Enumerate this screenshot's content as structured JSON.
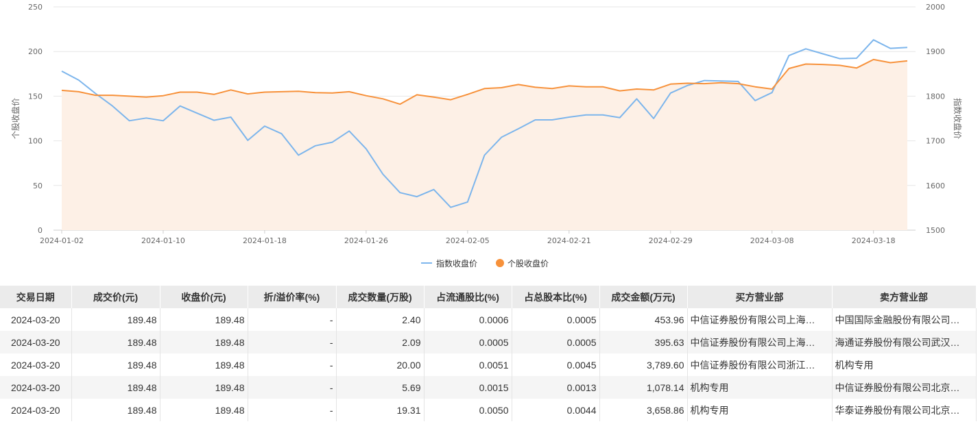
{
  "chart_data": {
    "type": "line",
    "x": [
      "2024-01-02",
      "2024-01-03",
      "2024-01-04",
      "2024-01-05",
      "2024-01-08",
      "2024-01-09",
      "2024-01-10",
      "2024-01-11",
      "2024-01-12",
      "2024-01-15",
      "2024-01-16",
      "2024-01-17",
      "2024-01-18",
      "2024-01-19",
      "2024-01-22",
      "2024-01-23",
      "2024-01-24",
      "2024-01-25",
      "2024-01-26",
      "2024-01-29",
      "2024-01-30",
      "2024-01-31",
      "2024-02-01",
      "2024-02-02",
      "2024-02-05",
      "2024-02-06",
      "2024-02-07",
      "2024-02-08",
      "2024-02-19",
      "2024-02-20",
      "2024-02-21",
      "2024-02-22",
      "2024-02-23",
      "2024-02-26",
      "2024-02-27",
      "2024-02-28",
      "2024-02-29",
      "2024-03-01",
      "2024-03-04",
      "2024-03-05",
      "2024-03-06",
      "2024-03-07",
      "2024-03-08",
      "2024-03-11",
      "2024-03-12",
      "2024-03-13",
      "2024-03-14",
      "2024-03-15",
      "2024-03-18",
      "2024-03-19",
      "2024-03-20"
    ],
    "x_ticks": [
      "2024-01-02",
      "2024-01-10",
      "2024-01-18",
      "2024-01-26",
      "2024-02-05",
      "2024-02-21",
      "2024-02-29",
      "2024-03-08",
      "2024-03-18"
    ],
    "left_axis": {
      "label": "个股收盘价",
      "min": 0,
      "max": 250,
      "ticks": [
        0,
        50,
        100,
        150,
        200,
        250
      ]
    },
    "right_axis": {
      "label": "指数收盘价",
      "min": 1500,
      "max": 2000,
      "ticks": [
        1500,
        1600,
        1700,
        1800,
        1900,
        2000
      ]
    },
    "grid": true,
    "legend_position": "bottom-center",
    "series": [
      {
        "name": "指数收盘价",
        "axis": "right",
        "type": "line",
        "color": "#7cb5ec",
        "values": [
          1856,
          1836,
          1806,
          1778,
          1745,
          1751,
          1745,
          1778,
          1762,
          1746,
          1753,
          1701,
          1733,
          1716,
          1668,
          1689,
          1697,
          1722,
          1682,
          1625,
          1584,
          1575,
          1591,
          1551,
          1563,
          1668,
          1708,
          1727,
          1747,
          1747,
          1753,
          1758,
          1758,
          1752,
          1794,
          1750,
          1807,
          1824,
          1835,
          1834,
          1833,
          1790,
          1808,
          1891,
          1906,
          1895,
          1884,
          1885,
          1926,
          1907,
          1909
        ]
      },
      {
        "name": "个股收盘价",
        "axis": "left",
        "type": "area",
        "color": "#f7913a",
        "values": [
          156.5,
          155,
          151,
          151,
          150,
          149,
          150.5,
          154.5,
          154.5,
          152,
          157,
          152.5,
          154.5,
          155,
          155.5,
          154,
          153.5,
          155,
          150.5,
          147,
          141,
          151.5,
          149,
          146,
          152,
          158.5,
          159.5,
          163,
          160,
          158.5,
          161.5,
          160.5,
          160.5,
          156,
          158,
          157,
          163.5,
          164.5,
          164,
          165,
          164,
          160.5,
          158,
          181,
          186,
          185.5,
          184.5,
          181.5,
          191,
          187.5,
          189.48
        ]
      }
    ]
  },
  "table": {
    "headers": [
      "交易日期",
      "成交价(元)",
      "收盘价(元)",
      "折/溢价率(%)",
      "成交数量(万股)",
      "占流通股比(%)",
      "占总股本比(%)",
      "成交金额(万元)",
      "买方营业部",
      "卖方营业部"
    ],
    "rows": [
      [
        "2024-03-20",
        "189.48",
        "189.48",
        "-",
        "2.40",
        "0.0006",
        "0.0005",
        "453.96",
        "中信证券股份有限公司上海…",
        "中国国际金融股份有限公司…"
      ],
      [
        "2024-03-20",
        "189.48",
        "189.48",
        "-",
        "2.09",
        "0.0005",
        "0.0005",
        "395.63",
        "中信证券股份有限公司上海…",
        "海通证券股份有限公司武汉…"
      ],
      [
        "2024-03-20",
        "189.48",
        "189.48",
        "-",
        "20.00",
        "0.0051",
        "0.0045",
        "3,789.60",
        "中信证券股份有限公司浙江…",
        "机构专用"
      ],
      [
        "2024-03-20",
        "189.48",
        "189.48",
        "-",
        "5.69",
        "0.0015",
        "0.0013",
        "1,078.14",
        "机构专用",
        "中信证券股份有限公司北京…"
      ],
      [
        "2024-03-20",
        "189.48",
        "189.48",
        "-",
        "19.31",
        "0.0050",
        "0.0044",
        "3,658.86",
        "机构专用",
        "华泰证券股份有限公司北京…"
      ]
    ]
  }
}
